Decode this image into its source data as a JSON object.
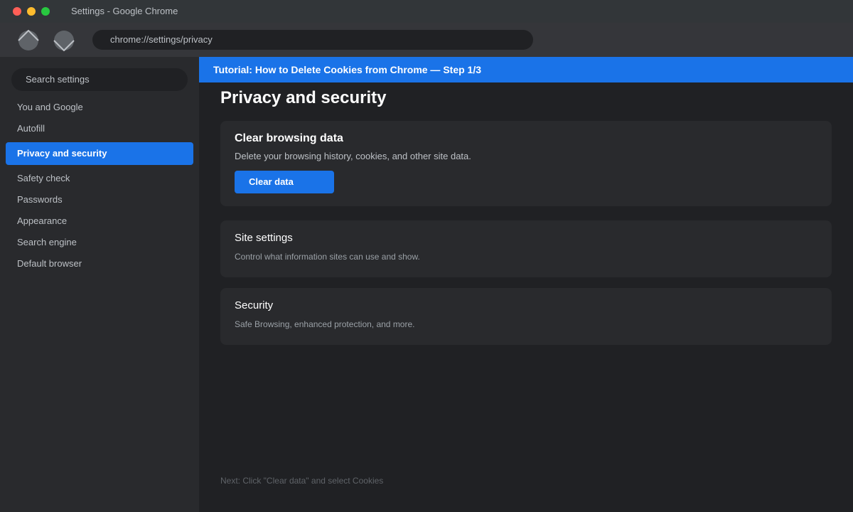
{
  "window": {
    "title": "Settings - Google Chrome"
  },
  "toolbar": {
    "back_icon": "chevron-up-icon",
    "forward_icon": "chevron-down-icon",
    "url": "chrome://settings/privacy"
  },
  "sidebar": {
    "search_placeholder": "Search settings",
    "items": [
      {
        "label": "You and Google"
      },
      {
        "label": "Autofill"
      },
      {
        "label": "Privacy and security",
        "active": true
      },
      {
        "label": "Safety check"
      },
      {
        "label": "Passwords"
      },
      {
        "label": "Appearance"
      },
      {
        "label": "Search engine"
      },
      {
        "label": "Default browser"
      }
    ]
  },
  "main": {
    "banner": "Tutorial: How to Delete Cookies from Chrome — Step 1/3",
    "title": "Privacy and security",
    "cards": [
      {
        "title": "Clear browsing data",
        "description": "Delete your browsing history, cookies, and other site data.",
        "button": "Clear data"
      },
      {
        "title": "Site settings",
        "description": "Control what information sites can use and show."
      },
      {
        "title": "Security",
        "description": "Safe Browsing, enhanced protection, and more."
      }
    ],
    "hint": "Next: Click \"Clear data\" and select Cookies"
  },
  "colors": {
    "accent": "#1a73e8",
    "background": "#202124",
    "sidebar": "#292a2d",
    "toolbar": "#35363a"
  }
}
